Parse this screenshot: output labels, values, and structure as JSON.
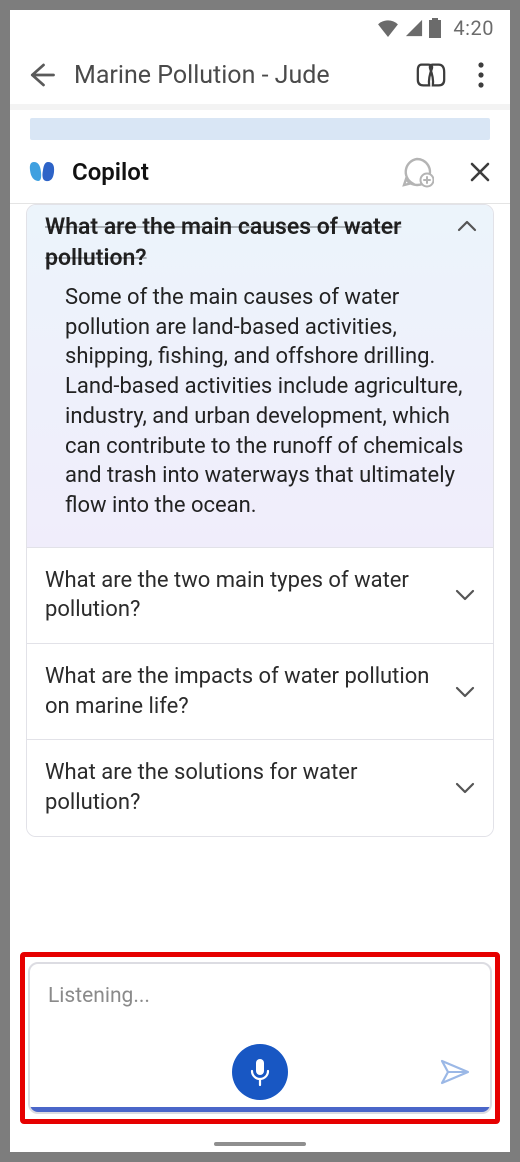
{
  "status": {
    "time": "4:20"
  },
  "header": {
    "title": "Marine Pollution - Jude"
  },
  "copilot": {
    "title": "Copilot"
  },
  "qa": {
    "expanded": {
      "question": "What are the main causes of water pollution?",
      "answer": "Some of the main causes of water pollution are land-based activities, shipping, fishing, and offshore drilling. Land-based activities include agriculture, industry, and urban development, which can contribute to the runoff of chemicals and trash into waterways that ultimately flow into the ocean."
    },
    "collapsed": [
      {
        "question": "What are the two main types of water pollution?"
      },
      {
        "question": "What are the impacts of water pollution on marine life?"
      },
      {
        "question": "What are the solutions for water pollution?"
      }
    ]
  },
  "input": {
    "placeholder": "Listening..."
  }
}
